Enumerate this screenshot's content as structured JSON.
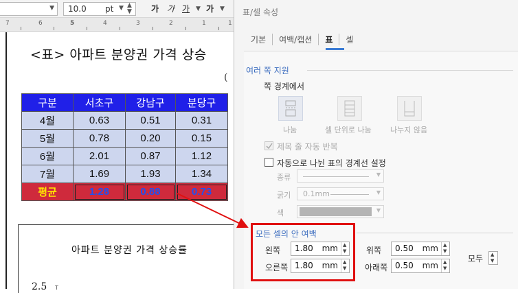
{
  "toolbar": {
    "font_size": "10.0",
    "font_unit": "pt",
    "fmt_bold": "가",
    "fmt_italic": "가",
    "fmt_underline": "가",
    "fmt_strike": "가"
  },
  "ruler": {
    "ticks": [
      "7",
      "6",
      "5",
      "4",
      "3",
      "2",
      "1",
      "1"
    ]
  },
  "document": {
    "title": "<표> 아파트 분양권 가격 상승",
    "unit_fragment": "(",
    "table": {
      "headers": [
        "구분",
        "서초구",
        "강남구",
        "분당구"
      ],
      "rows": [
        [
          "4월",
          "0.63",
          "0.51",
          "0.31"
        ],
        [
          "5월",
          "0.78",
          "0.20",
          "0.15"
        ],
        [
          "6월",
          "2.01",
          "0.87",
          "1.12"
        ],
        [
          "7월",
          "1.69",
          "1.93",
          "1.34"
        ]
      ],
      "avg": [
        "평균",
        "1.28",
        "0.88",
        "0.73"
      ]
    },
    "chart_title": "아파트 분양권 가격 상승률",
    "chart_ytick_value": "2.5",
    "chart_ytick_mark": "T"
  },
  "dialog": {
    "title": "표/셀 속성",
    "tabs": [
      "기본",
      "여백/캡션",
      "표",
      "셀"
    ],
    "active_tab": 2,
    "split": {
      "title": "여러 쪽 지원",
      "boundary_label": "쪽 경계에서",
      "option_split": "나눔",
      "option_cell": "셀 단위로 나눔",
      "option_none": "나누지 않음",
      "repeat_title": "제목 줄 자동 반복",
      "auto_border": "자동으로 나뉜 표의 경계선 설정",
      "type_label": "종류",
      "width_label": "굵기",
      "width_value": "0.1mm",
      "color_label": "색"
    },
    "margins": {
      "title": "모든 셀의 안 여백",
      "left_label": "왼쪽",
      "left_value": "1.80",
      "right_label": "오른쪽",
      "right_value": "1.80",
      "top_label": "위쪽",
      "top_value": "0.50",
      "bottom_label": "아래쪽",
      "bottom_value": "0.50",
      "unit": "mm",
      "all_label": "모두"
    }
  },
  "colors": {
    "header_bg": "#2020e8",
    "data_bg": "#cdd6ee",
    "avg_bg": "#cf2a3c",
    "highlight": "#e01010",
    "section_title": "#3f6fc0"
  }
}
